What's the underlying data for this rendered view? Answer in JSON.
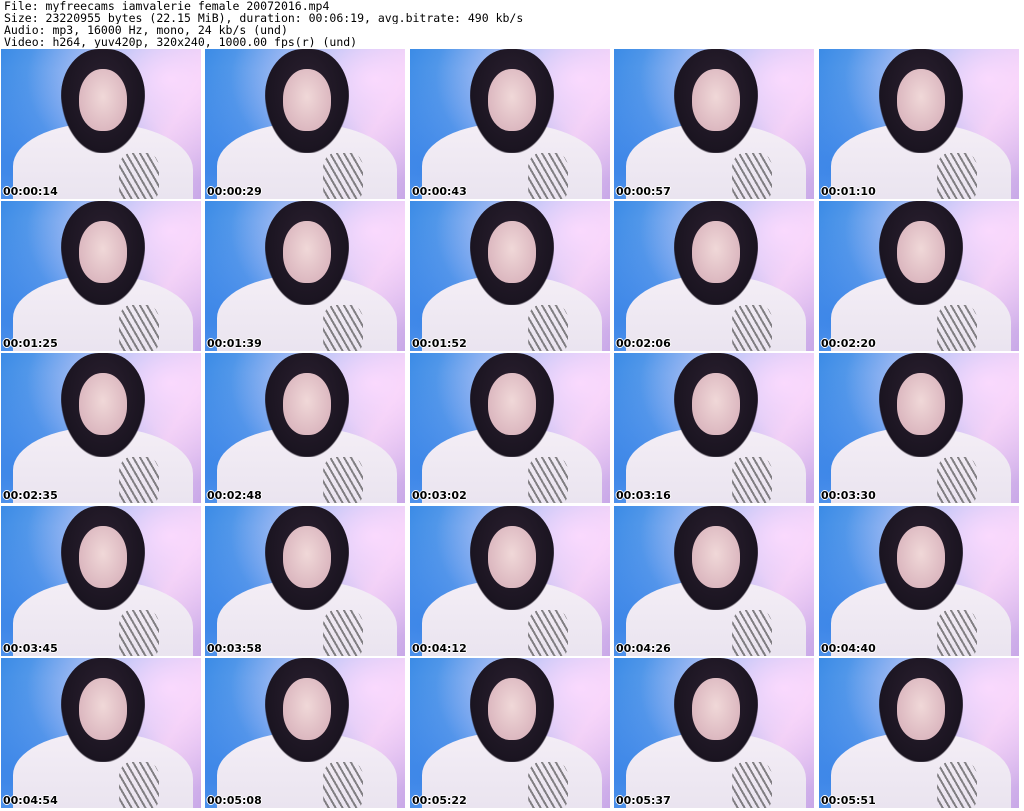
{
  "header": {
    "file": "File: myfreecams_iamvalerie_female_20072016.mp4",
    "size": "Size: 23220955 bytes (22.15 MiB), duration: 00:06:19, avg.bitrate: 490 kb/s",
    "audio": "Audio: mp3, 16000 Hz, mono, 24 kb/s (und)",
    "video": "Video: h264, yuv420p, 320x240, 1000.00 fps(r) (und)"
  },
  "thumbnails": [
    "00:00:14",
    "00:00:29",
    "00:00:43",
    "00:00:57",
    "00:01:10",
    "00:01:25",
    "00:01:39",
    "00:01:52",
    "00:02:06",
    "00:02:20",
    "00:02:35",
    "00:02:48",
    "00:03:02",
    "00:03:16",
    "00:03:30",
    "00:03:45",
    "00:03:58",
    "00:04:12",
    "00:04:26",
    "00:04:40",
    "00:04:54",
    "00:05:08",
    "00:05:22",
    "00:05:37",
    "00:05:51"
  ]
}
